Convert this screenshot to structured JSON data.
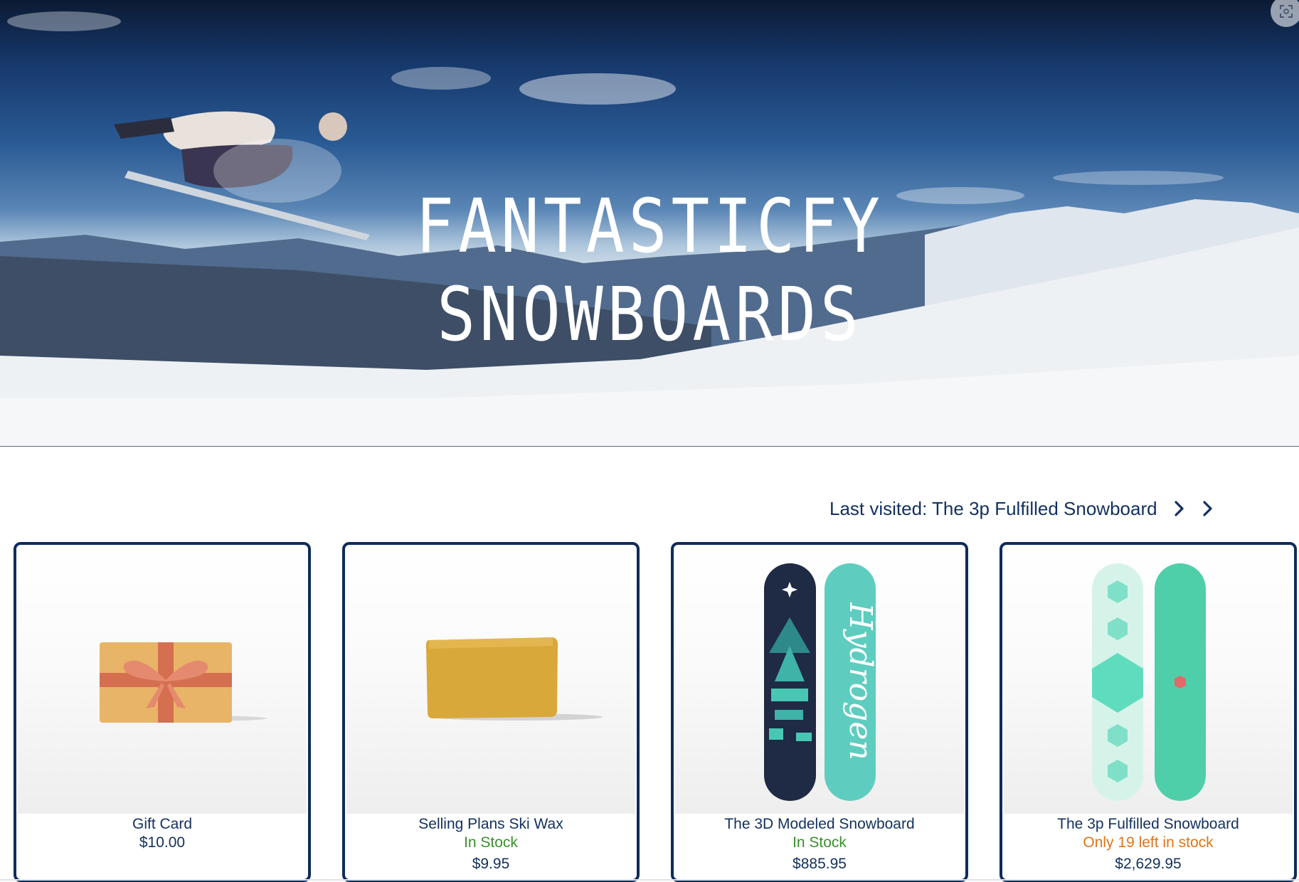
{
  "hero": {
    "title_line1": "FANTASTICFY",
    "title_line2": "SNOWBOARDS",
    "fullscreen_icon": "screenshot-focus-icon"
  },
  "last_visited": {
    "label": "Last visited: The 3p Fulfilled Snowboard",
    "icons": [
      "chevron-right-icon",
      "chevron-right-icon"
    ]
  },
  "products": [
    {
      "title": "Gift Card",
      "stock": "",
      "price": "$10.00",
      "image": "gift-card-icon"
    },
    {
      "title": "Selling Plans Ski Wax",
      "stock": "In Stock",
      "price": "$9.95",
      "image": "ski-wax-icon"
    },
    {
      "title": "The 3D Modeled Snowboard",
      "stock": "In Stock",
      "price": "$885.95",
      "image": "snowboard-hydrogen-icon"
    },
    {
      "title": "The 3p Fulfilled Snowboard",
      "stock": "Only 19 left in stock",
      "price": "$2,629.95",
      "image": "snowboard-hexagon-icon"
    }
  ],
  "colors": {
    "brand_navy": "#0f2b5c",
    "text_navy": "#12305f",
    "in_stock_green": "#3a8f2c",
    "low_stock_orange": "#e07418"
  }
}
